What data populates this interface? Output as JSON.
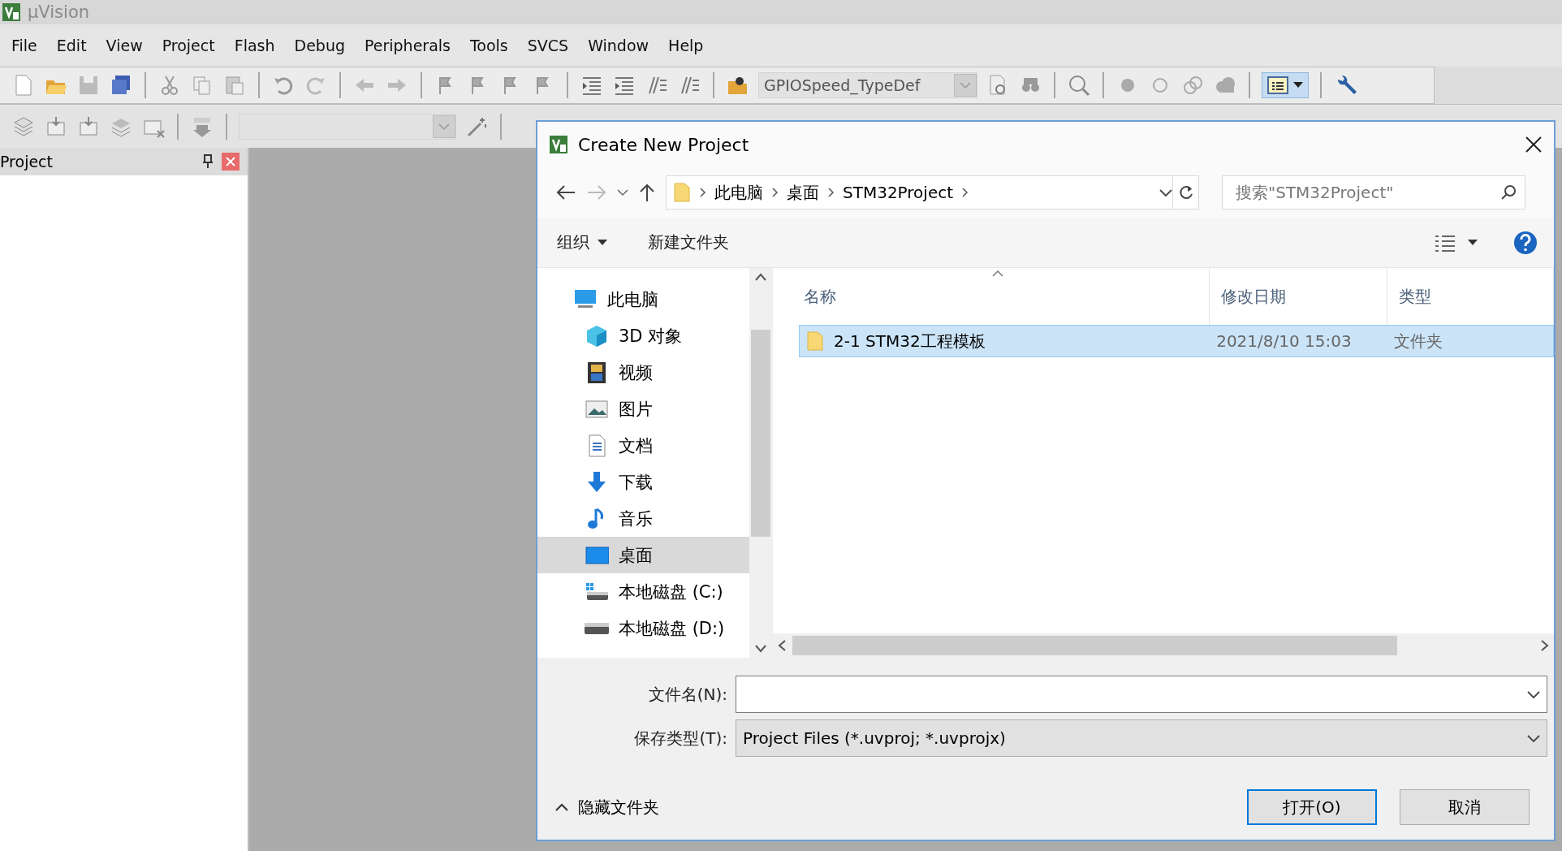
{
  "app": {
    "title": "µVision"
  },
  "menu": [
    "File",
    "Edit",
    "View",
    "Project",
    "Flash",
    "Debug",
    "Peripherals",
    "Tools",
    "SVCS",
    "Window",
    "Help"
  ],
  "toolbar": {
    "find_combo": {
      "value": "GPIOSpeed_TypeDef"
    }
  },
  "project_panel": {
    "title": "Project"
  },
  "dialog": {
    "title": "Create New Project",
    "breadcrumb": [
      "此电脑",
      "桌面",
      "STM32Project"
    ],
    "search": {
      "placeholder": "搜索\"STM32Project\""
    },
    "commands": [
      {
        "label": "组织",
        "kind": "dropdown"
      },
      {
        "label": "新建文件夹",
        "kind": "plain"
      }
    ],
    "nav": [
      {
        "label": "此电脑",
        "kind": "computer",
        "selected": false,
        "children": [
          {
            "label": "3D 对象",
            "kind": "cube",
            "selected": false
          },
          {
            "label": "视频",
            "kind": "video",
            "selected": false
          },
          {
            "label": "图片",
            "kind": "picture",
            "selected": false
          },
          {
            "label": "文档",
            "kind": "document",
            "selected": false
          },
          {
            "label": "下载",
            "kind": "download",
            "selected": false
          },
          {
            "label": "音乐",
            "kind": "music",
            "selected": false
          },
          {
            "label": "桌面",
            "kind": "desktop",
            "selected": true
          },
          {
            "label": "本地磁盘 (C:)",
            "kind": "system-drive",
            "selected": false
          },
          {
            "label": "本地磁盘 (D:)",
            "kind": "drive",
            "selected": false
          }
        ]
      }
    ],
    "columns": [
      "名称",
      "修改日期",
      "类型"
    ],
    "rows": [
      {
        "name": "2-1 STM32工程模板",
        "date": "2021/8/10 15:03",
        "type": "文件夹",
        "selected": true
      }
    ],
    "file_name": {
      "label": "文件名(N):"
    },
    "file_type": {
      "label": "保存类型(T):",
      "value": "Project Files (*.uvproj; *.uvprojx)"
    },
    "hide_folders": "隐藏文件夹",
    "buttons": [
      {
        "label": "打开(O)",
        "default": true
      },
      {
        "label": "取消",
        "default": false
      }
    ]
  }
}
